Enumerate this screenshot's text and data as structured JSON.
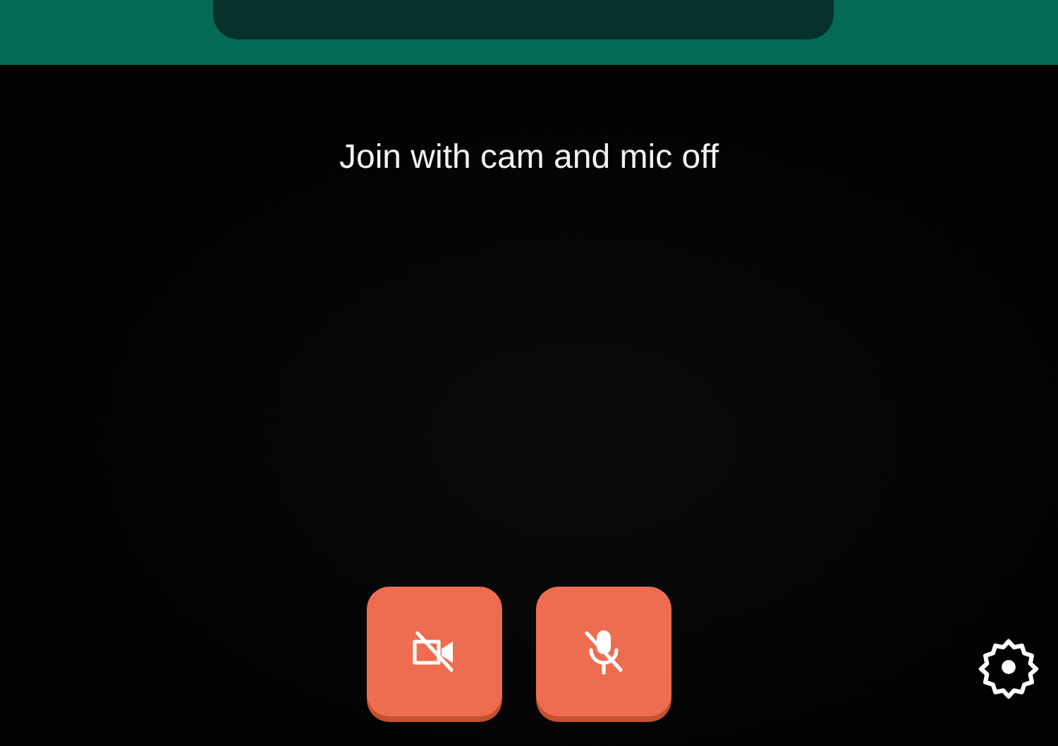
{
  "prompt": "Join with cam and mic off",
  "controls": [
    {
      "kind": "camera",
      "on": false
    },
    {
      "kind": "microphone",
      "on": false
    }
  ]
}
